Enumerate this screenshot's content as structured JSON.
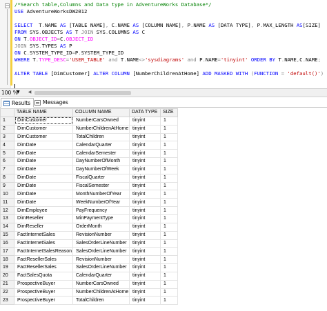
{
  "editor": {
    "outline_toggle": "−",
    "lines": [
      {
        "segments": [
          {
            "t": "/*Search table,Columns and Data type in AdventureWorks Database*/",
            "c": "cm"
          }
        ]
      },
      {
        "segments": [
          {
            "t": "USE ",
            "c": "kw"
          },
          {
            "t": "AdventureWorksDW2012",
            "c": ""
          }
        ]
      },
      {
        "segments": []
      },
      {
        "segments": [
          {
            "t": "SELECT  ",
            "c": "kw"
          },
          {
            "t": "T",
            "c": ""
          },
          {
            "t": ".",
            "c": "gr"
          },
          {
            "t": "NAME ",
            "c": ""
          },
          {
            "t": "AS ",
            "c": "kw"
          },
          {
            "t": "[TABLE NAME]",
            "c": ""
          },
          {
            "t": ", ",
            "c": "gr"
          },
          {
            "t": "C",
            "c": ""
          },
          {
            "t": ".",
            "c": "gr"
          },
          {
            "t": "NAME ",
            "c": ""
          },
          {
            "t": "AS ",
            "c": "kw"
          },
          {
            "t": "[COLUMN NAME]",
            "c": ""
          },
          {
            "t": ", ",
            "c": "gr"
          },
          {
            "t": "P",
            "c": ""
          },
          {
            "t": ".",
            "c": "gr"
          },
          {
            "t": "NAME ",
            "c": ""
          },
          {
            "t": "AS ",
            "c": "kw"
          },
          {
            "t": "[DATA TYPE]",
            "c": ""
          },
          {
            "t": ", ",
            "c": "gr"
          },
          {
            "t": "P",
            "c": ""
          },
          {
            "t": ".",
            "c": "gr"
          },
          {
            "t": "MAX_LENGTH ",
            "c": ""
          },
          {
            "t": "AS",
            "c": "kw"
          },
          {
            "t": "[SIZE]",
            "c": ""
          }
        ]
      },
      {
        "segments": [
          {
            "t": "FROM ",
            "c": "kw"
          },
          {
            "t": "SYS",
            "c": ""
          },
          {
            "t": ".",
            "c": "gr"
          },
          {
            "t": "OBJECTS ",
            "c": ""
          },
          {
            "t": "AS ",
            "c": "kw"
          },
          {
            "t": "T ",
            "c": ""
          },
          {
            "t": "JOIN ",
            "c": "gr"
          },
          {
            "t": "SYS",
            "c": ""
          },
          {
            "t": ".",
            "c": "gr"
          },
          {
            "t": "COLUMNS ",
            "c": ""
          },
          {
            "t": "AS ",
            "c": "kw"
          },
          {
            "t": "C",
            "c": ""
          }
        ]
      },
      {
        "segments": [
          {
            "t": "ON ",
            "c": "kw"
          },
          {
            "t": "T",
            "c": ""
          },
          {
            "t": ".",
            "c": "gr"
          },
          {
            "t": "OBJECT_ID",
            "c": "fn"
          },
          {
            "t": "=",
            "c": "gr"
          },
          {
            "t": "C",
            "c": ""
          },
          {
            "t": ".",
            "c": "gr"
          },
          {
            "t": "OBJECT_ID",
            "c": "fn"
          }
        ]
      },
      {
        "segments": [
          {
            "t": "JOIN ",
            "c": "gr"
          },
          {
            "t": "SYS",
            "c": ""
          },
          {
            "t": ".",
            "c": "gr"
          },
          {
            "t": "TYPES ",
            "c": ""
          },
          {
            "t": "AS ",
            "c": "kw"
          },
          {
            "t": "P",
            "c": ""
          }
        ]
      },
      {
        "segments": [
          {
            "t": "ON ",
            "c": "kw"
          },
          {
            "t": "C",
            "c": ""
          },
          {
            "t": ".",
            "c": "gr"
          },
          {
            "t": "SYSTEM_TYPE_ID",
            "c": ""
          },
          {
            "t": "=",
            "c": "gr"
          },
          {
            "t": "P",
            "c": ""
          },
          {
            "t": ".",
            "c": "gr"
          },
          {
            "t": "SYSTEM_TYPE_ID",
            "c": ""
          }
        ]
      },
      {
        "segments": [
          {
            "t": "WHERE ",
            "c": "kw"
          },
          {
            "t": "T",
            "c": ""
          },
          {
            "t": ".",
            "c": "gr"
          },
          {
            "t": "TYPE_DESC",
            "c": "fn"
          },
          {
            "t": "=",
            "c": "gr"
          },
          {
            "t": "'USER_TABLE'",
            "c": "st"
          },
          {
            "t": " and ",
            "c": "gr"
          },
          {
            "t": "T",
            "c": ""
          },
          {
            "t": ".",
            "c": "gr"
          },
          {
            "t": "NAME",
            "c": ""
          },
          {
            "t": "<>",
            "c": "gr"
          },
          {
            "t": "'sysdiagrams'",
            "c": "st"
          },
          {
            "t": " and ",
            "c": "gr"
          },
          {
            "t": "P",
            "c": ""
          },
          {
            "t": ".",
            "c": "gr"
          },
          {
            "t": "NAME",
            "c": ""
          },
          {
            "t": "=",
            "c": "gr"
          },
          {
            "t": "'tinyint'",
            "c": "st"
          },
          {
            "t": " ORDER BY ",
            "c": "kw"
          },
          {
            "t": "T",
            "c": ""
          },
          {
            "t": ".",
            "c": "gr"
          },
          {
            "t": "NAME",
            "c": ""
          },
          {
            "t": ",",
            "c": "gr"
          },
          {
            "t": "C",
            "c": ""
          },
          {
            "t": ".",
            "c": "gr"
          },
          {
            "t": "NAME",
            "c": ""
          },
          {
            "t": ";",
            "c": "gr"
          }
        ]
      },
      {
        "segments": []
      },
      {
        "segments": [
          {
            "t": "ALTER TABLE ",
            "c": "kw"
          },
          {
            "t": "[DimCustomer] ",
            "c": ""
          },
          {
            "t": "ALTER COLUMN ",
            "c": "kw"
          },
          {
            "t": "[NumberChildrenAtHome] ",
            "c": ""
          },
          {
            "t": "ADD MASKED WITH ",
            "c": "kw"
          },
          {
            "t": "(",
            "c": "gr"
          },
          {
            "t": "FUNCTION ",
            "c": "kw"
          },
          {
            "t": "= ",
            "c": "gr"
          },
          {
            "t": "'default()'",
            "c": "st"
          },
          {
            "t": ")",
            "c": "gr"
          }
        ]
      }
    ]
  },
  "zoom": {
    "value": "100 %"
  },
  "tabs": [
    {
      "label": "Results",
      "icon": "grid-icon",
      "active": true
    },
    {
      "label": "Messages",
      "icon": "messages-icon",
      "active": false
    }
  ],
  "results": {
    "columns": [
      "TABLE NAME",
      "COLUMN NAME",
      "DATA TYPE",
      "SIZE"
    ],
    "rows": [
      [
        "1",
        "DimCustomer",
        "NumberCarsOwned",
        "tinyint",
        "1"
      ],
      [
        "2",
        "DimCustomer",
        "NumberChildrenAtHome",
        "tinyint",
        "1"
      ],
      [
        "3",
        "DimCustomer",
        "TotalChildren",
        "tinyint",
        "1"
      ],
      [
        "4",
        "DimDate",
        "CalendarQuarter",
        "tinyint",
        "1"
      ],
      [
        "5",
        "DimDate",
        "CalendarSemester",
        "tinyint",
        "1"
      ],
      [
        "6",
        "DimDate",
        "DayNumberOfMonth",
        "tinyint",
        "1"
      ],
      [
        "7",
        "DimDate",
        "DayNumberOfWeek",
        "tinyint",
        "1"
      ],
      [
        "8",
        "DimDate",
        "FiscalQuarter",
        "tinyint",
        "1"
      ],
      [
        "9",
        "DimDate",
        "FiscalSemester",
        "tinyint",
        "1"
      ],
      [
        "10",
        "DimDate",
        "MonthNumberOfYear",
        "tinyint",
        "1"
      ],
      [
        "11",
        "DimDate",
        "WeekNumberOfYear",
        "tinyint",
        "1"
      ],
      [
        "12",
        "DimEmployee",
        "PayFrequency",
        "tinyint",
        "1"
      ],
      [
        "13",
        "DimReseller",
        "MinPaymentType",
        "tinyint",
        "1"
      ],
      [
        "14",
        "DimReseller",
        "OrderMonth",
        "tinyint",
        "1"
      ],
      [
        "15",
        "FactInternetSales",
        "RevisionNumber",
        "tinyint",
        "1"
      ],
      [
        "16",
        "FactInternetSales",
        "SalesOrderLineNumber",
        "tinyint",
        "1"
      ],
      [
        "17",
        "FactInternetSalesReason",
        "SalesOrderLineNumber",
        "tinyint",
        "1"
      ],
      [
        "18",
        "FactResellerSales",
        "RevisionNumber",
        "tinyint",
        "1"
      ],
      [
        "19",
        "FactResellerSales",
        "SalesOrderLineNumber",
        "tinyint",
        "1"
      ],
      [
        "20",
        "FactSalesQuota",
        "CalendarQuarter",
        "tinyint",
        "1"
      ],
      [
        "21",
        "ProspectiveBuyer",
        "NumberCarsOwned",
        "tinyint",
        "1"
      ],
      [
        "22",
        "ProspectiveBuyer",
        "NumberChildrenAtHome",
        "tinyint",
        "1"
      ],
      [
        "23",
        "ProspectiveBuyer",
        "TotalChildren",
        "tinyint",
        "1"
      ]
    ]
  }
}
